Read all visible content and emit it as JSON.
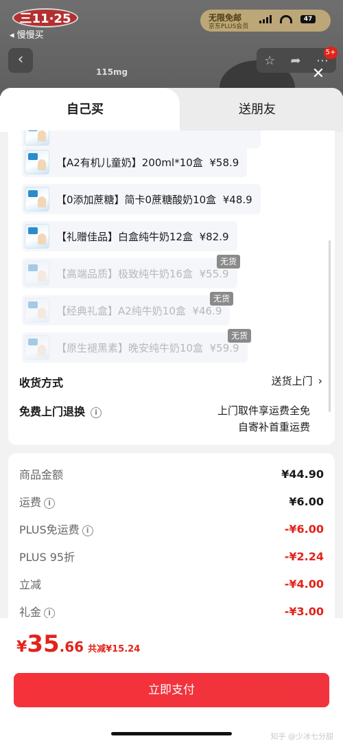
{
  "background": {
    "logo_text": "三11·25",
    "back_to_app": "◂ 慢慢买",
    "promo_title": "无限免邮",
    "promo_sub": "京东PLUS会员",
    "battery": "47",
    "cart_badge": "5+",
    "product_label": "115mg"
  },
  "tabs": {
    "self": "自己买",
    "friend": "送朋友"
  },
  "options": [
    {
      "label": "【A2有机儿童奶】200ml*10盒",
      "price": "¥58.9",
      "out_of_stock": false
    },
    {
      "label": "【0添加蔗糖】简卡0蔗糖酸奶10盒",
      "price": "¥48.9",
      "out_of_stock": false
    },
    {
      "label": "【礼赠佳品】白盒纯牛奶12盒",
      "price": "¥82.9",
      "out_of_stock": false
    },
    {
      "label": "【高端品质】极致纯牛奶16盒",
      "price": "¥55.9",
      "out_of_stock": true
    },
    {
      "label": "【经典礼盒】A2纯牛奶10盒",
      "price": "¥46.9",
      "out_of_stock": true
    },
    {
      "label": "【原生褪黑素】晚安纯牛奶10盒",
      "price": "¥59.9",
      "out_of_stock": true
    }
  ],
  "oos_tag": "无货",
  "delivery": {
    "label": "收货方式",
    "value": "送货上门"
  },
  "return": {
    "label": "免费上门退换",
    "line1": "上门取件享运费全免",
    "line2": "自寄补首重运费"
  },
  "fees": [
    {
      "label": "商品金额",
      "value": "¥44.90",
      "info": false,
      "red": false
    },
    {
      "label": "运费",
      "value": "¥6.00",
      "info": true,
      "red": false
    },
    {
      "label": "PLUS免运费",
      "value": "-¥6.00",
      "info": true,
      "red": true
    },
    {
      "label": "PLUS 95折",
      "value": "-¥2.24",
      "info": false,
      "red": true
    },
    {
      "label": "立减",
      "value": "-¥4.00",
      "info": false,
      "red": true
    },
    {
      "label": "礼金",
      "value": "-¥3.00",
      "info": true,
      "red": true
    }
  ],
  "total": {
    "currency": "¥",
    "integer": "35",
    "decimal": ".66",
    "saved": "共减¥15.24"
  },
  "pay_button": "立即支付",
  "watermark": "知乎 @少冰七分甜",
  "colors": {
    "accent_red": "#e2231a",
    "pay_button": "#f5323a",
    "oos_tag": "#8a8a8a"
  }
}
